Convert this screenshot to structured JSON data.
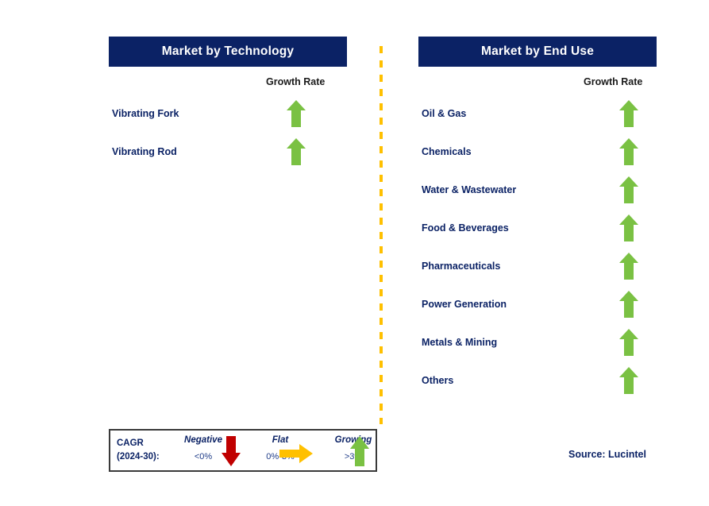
{
  "colors": {
    "navy": "#0B2265",
    "green": "#7AC143",
    "red": "#C00000",
    "amber": "#FFC000",
    "label_blue": "#0B2265",
    "background": "#FFFFFF"
  },
  "divider": {
    "icon": "vertical-dashed-line-icon",
    "color": "#FFC000"
  },
  "panels": [
    {
      "id": "market-by-technology",
      "title": "Market by Technology",
      "growth_caption": "Growth Rate",
      "items": [
        {
          "label": "Vibrating Fork",
          "trend": "up",
          "icon": "arrow-up-icon"
        },
        {
          "label": "Vibrating Rod",
          "trend": "up",
          "icon": "arrow-up-icon"
        }
      ]
    },
    {
      "id": "market-by-end-use",
      "title": "Market by End Use",
      "growth_caption": "Growth Rate",
      "items": [
        {
          "label": "Oil & Gas",
          "trend": "up",
          "icon": "arrow-up-icon"
        },
        {
          "label": "Chemicals",
          "trend": "up",
          "icon": "arrow-up-icon"
        },
        {
          "label": "Water & Wastewater",
          "trend": "up",
          "icon": "arrow-up-icon"
        },
        {
          "label": "Food & Beverages",
          "trend": "up",
          "icon": "arrow-up-icon"
        },
        {
          "label": "Pharmaceuticals",
          "trend": "up",
          "icon": "arrow-up-icon"
        },
        {
          "label": "Power Generation",
          "trend": "up",
          "icon": "arrow-up-icon"
        },
        {
          "label": "Metals & Mining",
          "trend": "up",
          "icon": "arrow-up-icon"
        },
        {
          "label": "Others",
          "trend": "up",
          "icon": "arrow-up-icon"
        }
      ]
    }
  ],
  "legend": {
    "title_line1": "CAGR",
    "title_line2": "(2024-30):",
    "entries": [
      {
        "name": "Negative",
        "range": "<0%",
        "icon": "arrow-down-icon",
        "color": "#C00000"
      },
      {
        "name": "Flat",
        "range": "0%-3%",
        "icon": "arrow-right-icon",
        "color": "#FFC000"
      },
      {
        "name": "Growing",
        "range": ">3%",
        "icon": "arrow-up-icon",
        "color": "#7AC143"
      }
    ]
  },
  "source": "Source: Lucintel"
}
